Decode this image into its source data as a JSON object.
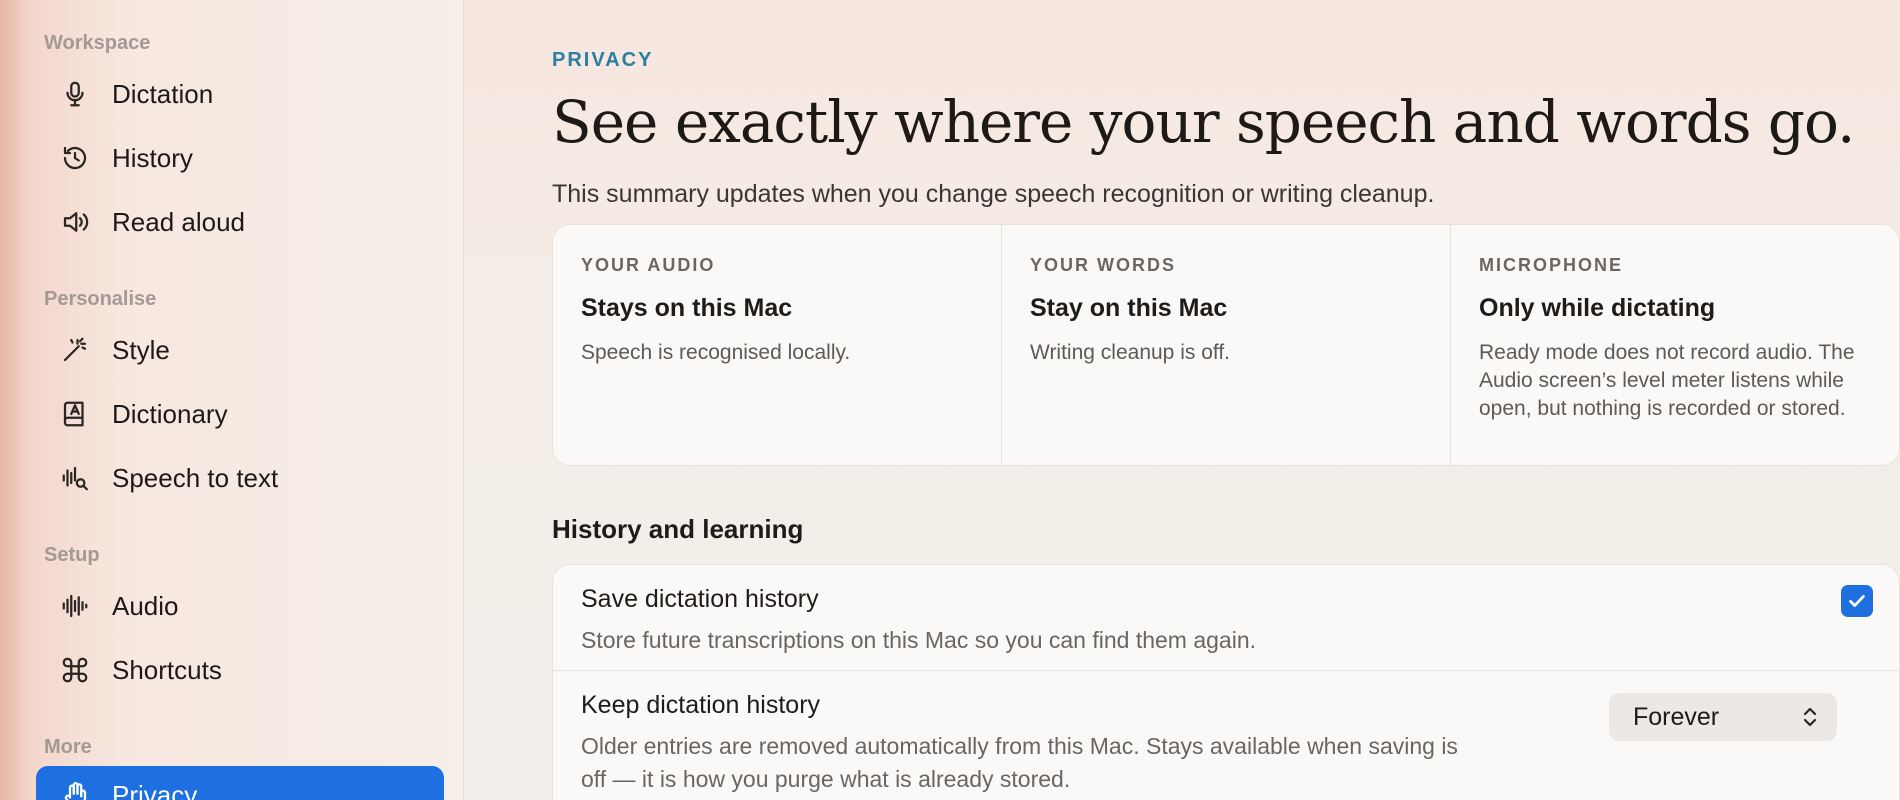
{
  "sidebar": {
    "sections": [
      {
        "label": "Workspace",
        "items": [
          {
            "label": "Dictation",
            "icon": "microphone-icon"
          },
          {
            "label": "History",
            "icon": "history-icon"
          },
          {
            "label": "Read aloud",
            "icon": "speaker-icon"
          }
        ]
      },
      {
        "label": "Personalise",
        "items": [
          {
            "label": "Style",
            "icon": "magic-wand-icon"
          },
          {
            "label": "Dictionary",
            "icon": "dictionary-icon"
          },
          {
            "label": "Speech to text",
            "icon": "waveform-search-icon"
          }
        ]
      },
      {
        "label": "Setup",
        "items": [
          {
            "label": "Audio",
            "icon": "waveform-icon"
          },
          {
            "label": "Shortcuts",
            "icon": "command-icon"
          }
        ]
      },
      {
        "label": "More",
        "items": [
          {
            "label": "Privacy",
            "icon": "hand-icon",
            "active": true
          }
        ]
      }
    ]
  },
  "main": {
    "eyebrow": "PRIVACY",
    "headline": "See exactly where your speech and words go.",
    "subhead": "This summary updates when you change speech recognition or writing cleanup.",
    "summary": [
      {
        "kicker": "YOUR AUDIO",
        "title": "Stays on this Mac",
        "desc": "Speech is recognised locally."
      },
      {
        "kicker": "YOUR WORDS",
        "title": "Stay on this Mac",
        "desc": "Writing cleanup is off."
      },
      {
        "kicker": "MICROPHONE",
        "title": "Only while dictating",
        "desc": "Ready mode does not record audio. The Audio screen’s level meter listens while open, but nothing is recorded or stored."
      }
    ],
    "history_section": {
      "heading": "History and learning",
      "save": {
        "title": "Save dictation history",
        "desc": "Store future transcriptions on this Mac so you can find them again.",
        "checked": true
      },
      "keep": {
        "title": "Keep dictation history",
        "desc": "Older entries are removed automatically from this Mac. Stays available when saving is off — it is how you purge what is already stored.",
        "value": "Forever"
      }
    }
  },
  "colors": {
    "accent": "#1e6fe0",
    "eyebrow": "#2a7fa0"
  }
}
